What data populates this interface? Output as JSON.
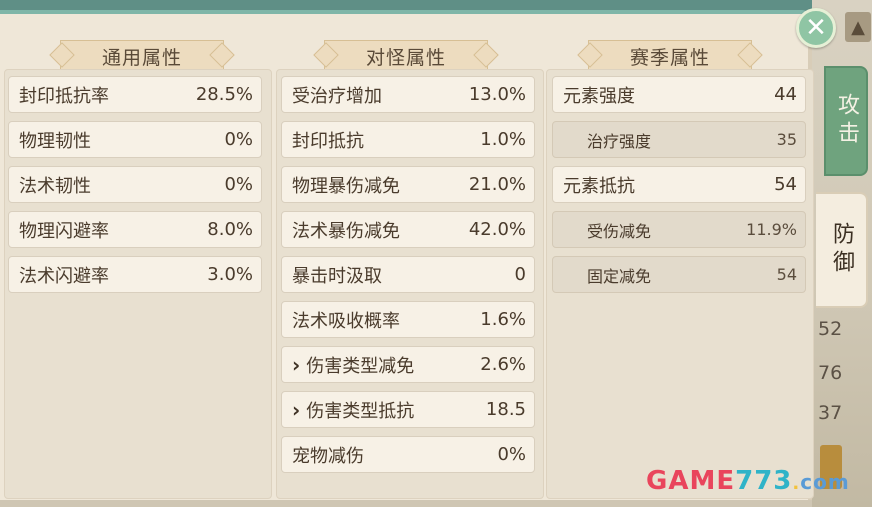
{
  "columns": [
    {
      "title": "通用属性",
      "rows": [
        {
          "label": "封印抵抗率",
          "value": "28.5%"
        },
        {
          "label": "物理韧性",
          "value": "0%"
        },
        {
          "label": "法术韧性",
          "value": "0%"
        },
        {
          "label": "物理闪避率",
          "value": "8.0%"
        },
        {
          "label": "法术闪避率",
          "value": "3.0%"
        }
      ]
    },
    {
      "title": "对怪属性",
      "rows": [
        {
          "label": "受治疗增加",
          "value": "13.0%"
        },
        {
          "label": "封印抵抗",
          "value": "1.0%"
        },
        {
          "label": "物理暴伤减免",
          "value": "21.0%"
        },
        {
          "label": "法术暴伤减免",
          "value": "42.0%"
        },
        {
          "label": "暴击时汲取",
          "value": "0"
        },
        {
          "label": "法术吸收概率",
          "value": "1.6%"
        },
        {
          "label": "伤害类型减免",
          "value": "2.6%",
          "expandable": true
        },
        {
          "label": "伤害类型抵抗",
          "value": "18.5",
          "expandable": true
        },
        {
          "label": "宠物减伤",
          "value": "0%"
        }
      ]
    },
    {
      "title": "赛季属性",
      "rows": [
        {
          "label": "元素强度",
          "value": "44"
        },
        {
          "label": "治疗强度",
          "value": "35",
          "sub": true
        },
        {
          "label": "元素抵抗",
          "value": "54"
        },
        {
          "label": "受伤减免",
          "value": "11.9%",
          "sub": true
        },
        {
          "label": "固定减免",
          "value": "54",
          "sub": true
        }
      ]
    }
  ],
  "tabs": [
    {
      "label": "攻击",
      "active": false
    },
    {
      "label": "防御",
      "active": true
    }
  ],
  "background_numbers": [
    "52",
    "76",
    "37"
  ],
  "watermark": {
    "part1": "GAME",
    "part2": "773",
    "dot": ".",
    "part3": "com"
  },
  "colors": {
    "panel": "#efe7d8",
    "accent_green": "#6fa37e",
    "row_bg": "#f7f1e6"
  }
}
